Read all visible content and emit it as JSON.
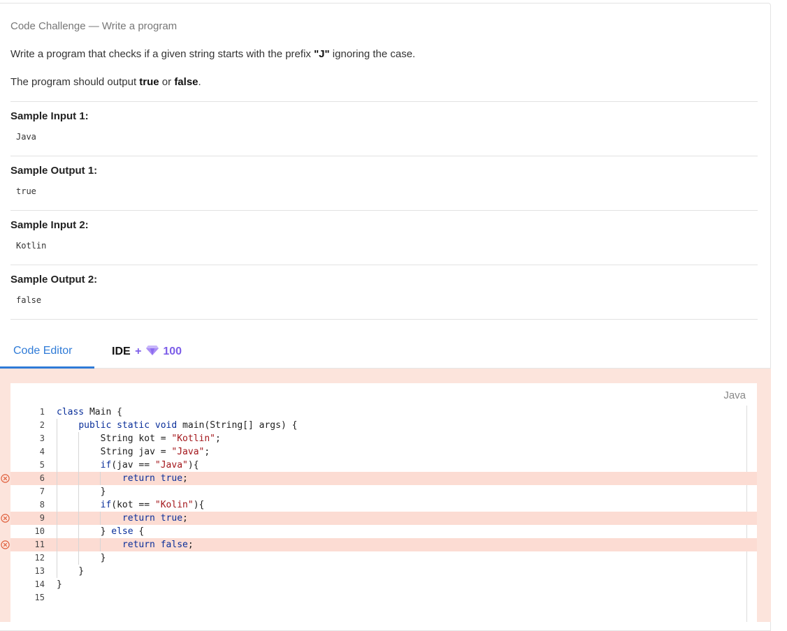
{
  "challenge": {
    "heading": "Code Challenge — Write a program",
    "description_pre": "Write a program that checks if a given string starts with the prefix ",
    "description_prefix": "\"J\"",
    "description_post": " ignoring the case.",
    "output_pre": "The program should output ",
    "output_true": "true",
    "output_or": " or ",
    "output_false": "false",
    "output_end": "."
  },
  "samples": [
    {
      "label": "Sample Input 1:",
      "value": "Java"
    },
    {
      "label": "Sample Output 1:",
      "value": "true"
    },
    {
      "label": "Sample Input 2:",
      "value": "Kotlin"
    },
    {
      "label": "Sample Output 2:",
      "value": "false"
    }
  ],
  "tabs": {
    "code_editor": "Code Editor",
    "ide": "IDE",
    "ide_plus": "+",
    "ide_cost": "100"
  },
  "editor": {
    "language": "Java",
    "line_numbers": [
      "1",
      "2",
      "3",
      "4",
      "5",
      "6",
      "7",
      "8",
      "9",
      "10",
      "11",
      "12",
      "13",
      "14",
      "15"
    ],
    "error_lines": [
      6,
      9,
      11
    ],
    "lines": [
      "class Main {",
      "    public static void main(String[] args) {",
      "        String kot = \"Kotlin\";",
      "        String jav = \"Java\";",
      "        if(jav == \"Java\"){",
      "            return true;",
      "        }",
      "        if(kot == \"Kolin\"){",
      "            return true;",
      "        } else {",
      "            return false;",
      "        }",
      "    }",
      "}",
      ""
    ]
  },
  "colors": {
    "accent": "#2f7bd7",
    "gem": "#7c5de8",
    "error_bg": "#fcdcd3",
    "error_icon": "#e0623f",
    "editor_bg": "#fce4dc"
  }
}
